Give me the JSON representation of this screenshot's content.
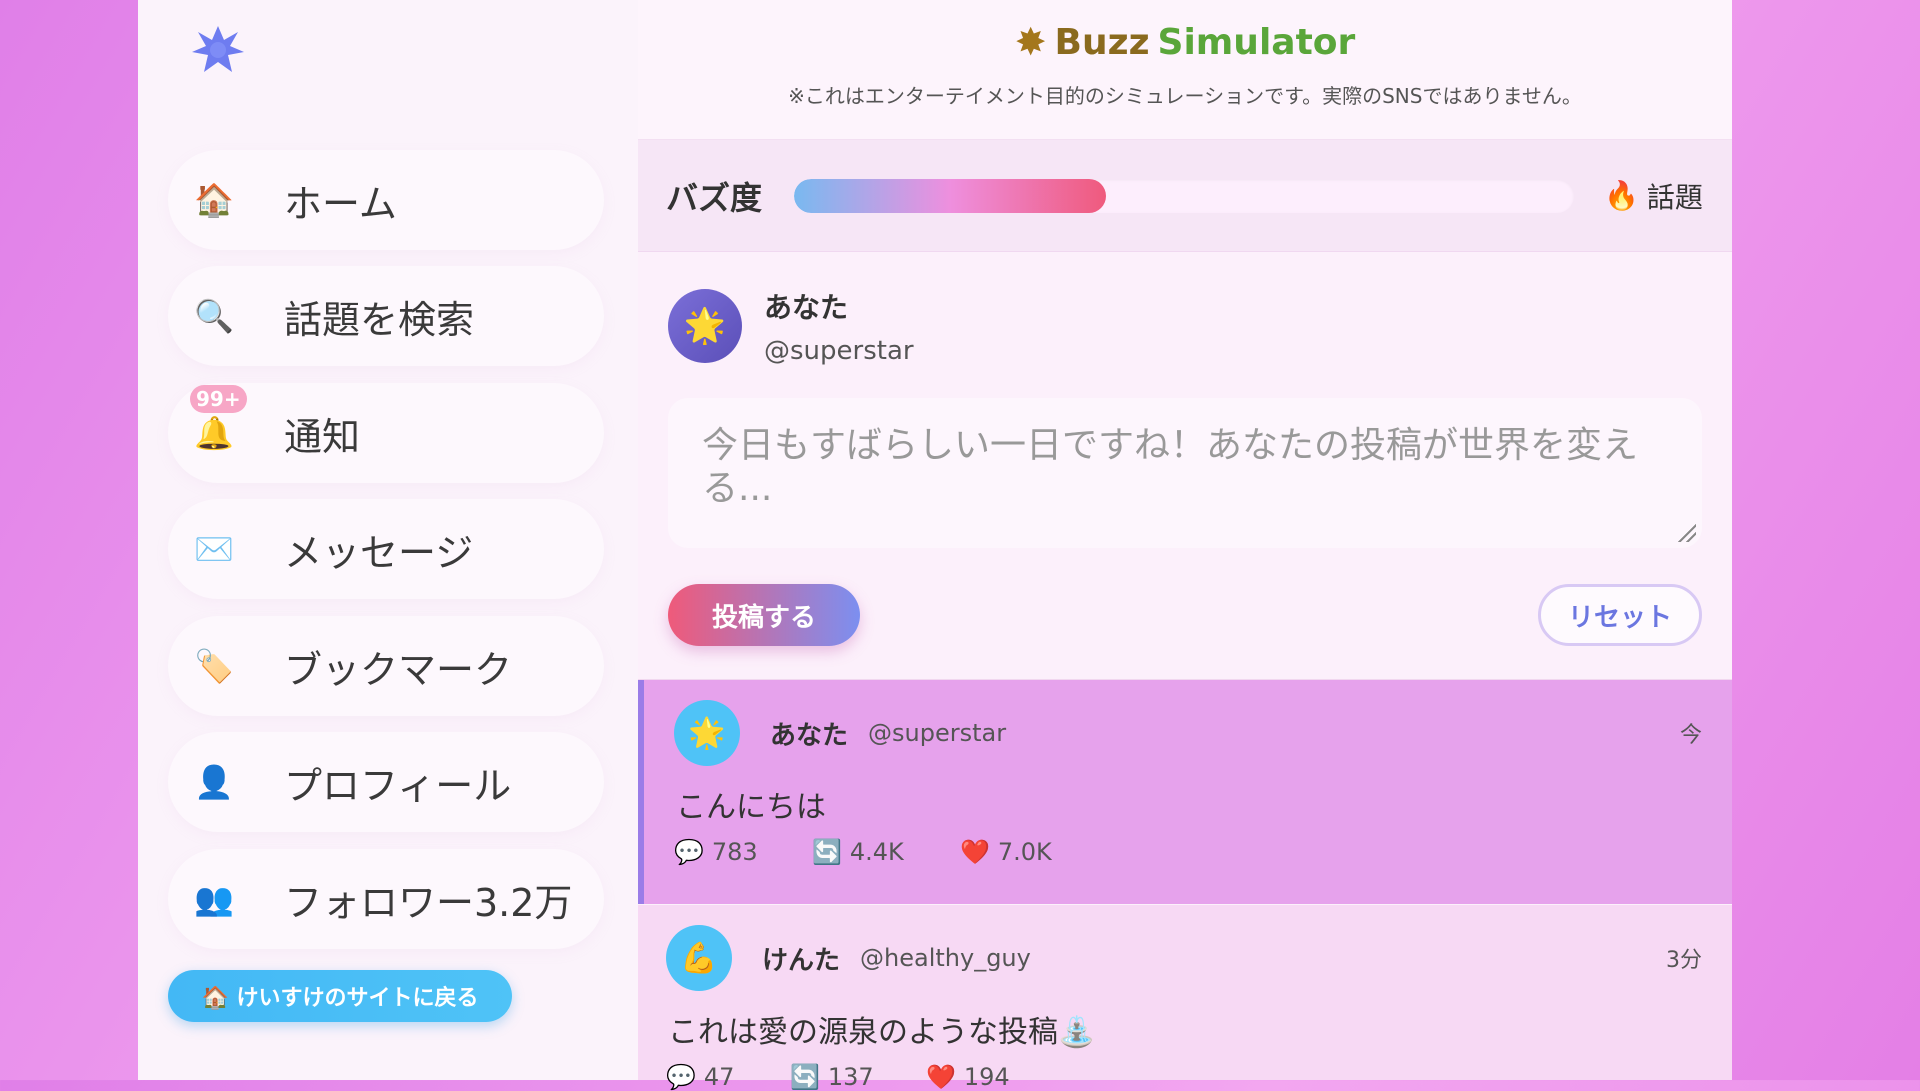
{
  "sidebar": {
    "logo_icon": "star-burst-icon",
    "items": [
      {
        "icon": "🏠",
        "label": "ホーム"
      },
      {
        "icon": "🔍",
        "label": "話題を検索"
      },
      {
        "icon": "🔔",
        "label": "通知",
        "badge": "99+"
      },
      {
        "icon": "✉️",
        "label": "メッセージ"
      },
      {
        "icon": "🏷️",
        "label": "ブックマーク"
      },
      {
        "icon": "👤",
        "label": "プロフィール"
      },
      {
        "icon": "👥",
        "label": "フォロワー3.2万"
      }
    ],
    "back_button": "🏠 けいすけのサイトに戻る"
  },
  "header": {
    "title_icon": "✸",
    "title_part1": "Buzz",
    "title_part2": "Simulator",
    "disclaimer": "※これはエンターテイメント目的のシミュレーションです。実際のSNSではありません。"
  },
  "buzz": {
    "label": "バズ度",
    "level": 0.4,
    "status_icon": "🔥",
    "status_text": "話題"
  },
  "composer": {
    "name": "あなた",
    "handle": "@superstar",
    "avatar": "🌟",
    "placeholder": "今日もすばらしい一日ですね！あなたの投稿が世界を変える...",
    "post_button": "投稿する",
    "reset_button": "リセット"
  },
  "posts": [
    {
      "avatar": "🌟",
      "name": "あなた",
      "handle": "@superstar",
      "time": "今",
      "body": "こんにちは",
      "comments": "783",
      "retweets": "4.4K",
      "likes": "7.0K",
      "avatar_color": "#4fc3f7"
    },
    {
      "avatar": "💪",
      "name": "けんた",
      "handle": "@healthy_guy",
      "time": "3分",
      "body": "これは愛の源泉のような投稿⛲",
      "comments": "47",
      "retweets": "137",
      "likes": "194",
      "avatar_color": "#4fc3f7"
    }
  ],
  "stat_icons": {
    "comment": "💬",
    "retweet": "🔄",
    "like": "❤️"
  }
}
